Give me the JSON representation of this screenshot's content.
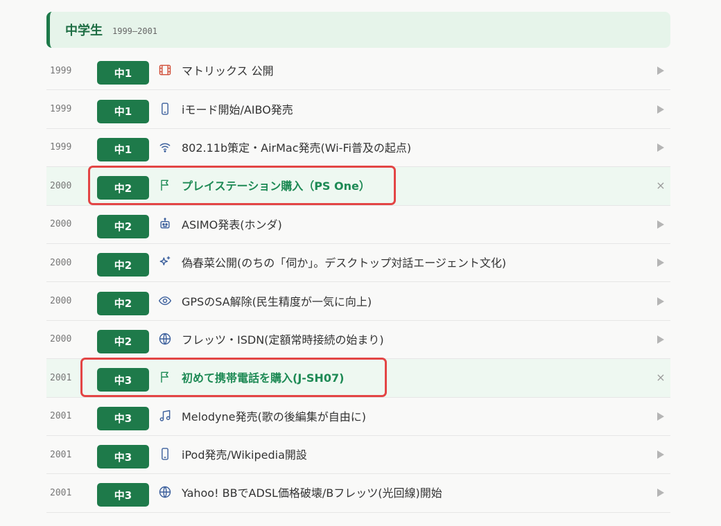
{
  "section": {
    "title": "中学生",
    "range": "1999–2001"
  },
  "events": [
    {
      "year": "1999",
      "grade": "中1",
      "icon": "film-icon",
      "title": "マトリックス 公開",
      "action": "expand-arrow",
      "highlight": false
    },
    {
      "year": "1999",
      "grade": "中1",
      "icon": "smartphone-icon",
      "title": "iモード開始/AIBO発売",
      "action": "expand-arrow",
      "highlight": false
    },
    {
      "year": "1999",
      "grade": "中1",
      "icon": "wifi-icon",
      "title": "802.11b策定・AirMac発売(Wi-Fi普及の起点)",
      "action": "expand-arrow",
      "highlight": false
    },
    {
      "year": "2000",
      "grade": "中2",
      "icon": "flag-icon",
      "title": "プレイステーション購入（PS One）",
      "action": "close",
      "highlight": true
    },
    {
      "year": "2000",
      "grade": "中2",
      "icon": "robot-icon",
      "title": "ASIMO発表(ホンダ)",
      "action": "expand-arrow",
      "highlight": false
    },
    {
      "year": "2000",
      "grade": "中2",
      "icon": "sparkle-icon",
      "title": "偽春菜公開(のちの「伺か」。デスクトップ対話エージェント文化)",
      "action": "expand-arrow",
      "highlight": false
    },
    {
      "year": "2000",
      "grade": "中2",
      "icon": "eye-icon",
      "title": "GPSのSA解除(民生精度が一気に向上)",
      "action": "expand-arrow",
      "highlight": false
    },
    {
      "year": "2000",
      "grade": "中2",
      "icon": "globe-icon",
      "title": "フレッツ・ISDN(定額常時接続の始まり)",
      "action": "expand-arrow",
      "highlight": false
    },
    {
      "year": "2001",
      "grade": "中3",
      "icon": "flag-icon",
      "title": "初めて携帯電話を購入(J-SH07)",
      "action": "close",
      "highlight": true
    },
    {
      "year": "2001",
      "grade": "中3",
      "icon": "music-icon",
      "title": "Melodyne発売(歌の後編集が自由に)",
      "action": "expand-arrow",
      "highlight": false
    },
    {
      "year": "2001",
      "grade": "中3",
      "icon": "smartphone-icon",
      "title": "iPod発売/Wikipedia開設",
      "action": "expand-arrow",
      "highlight": false
    },
    {
      "year": "2001",
      "grade": "中3",
      "icon": "globe-icon",
      "title": "Yahoo! BBでADSL価格破壊/Bフレッツ(光回線)開始",
      "action": "expand-arrow",
      "highlight": false
    }
  ],
  "colors": {
    "accent": "#1e7a4a",
    "highlight_bg": "#eef8f1",
    "highlight_text": "#1e8a55",
    "annotation": "#e34545",
    "header_bg": "#e6f4ea"
  }
}
